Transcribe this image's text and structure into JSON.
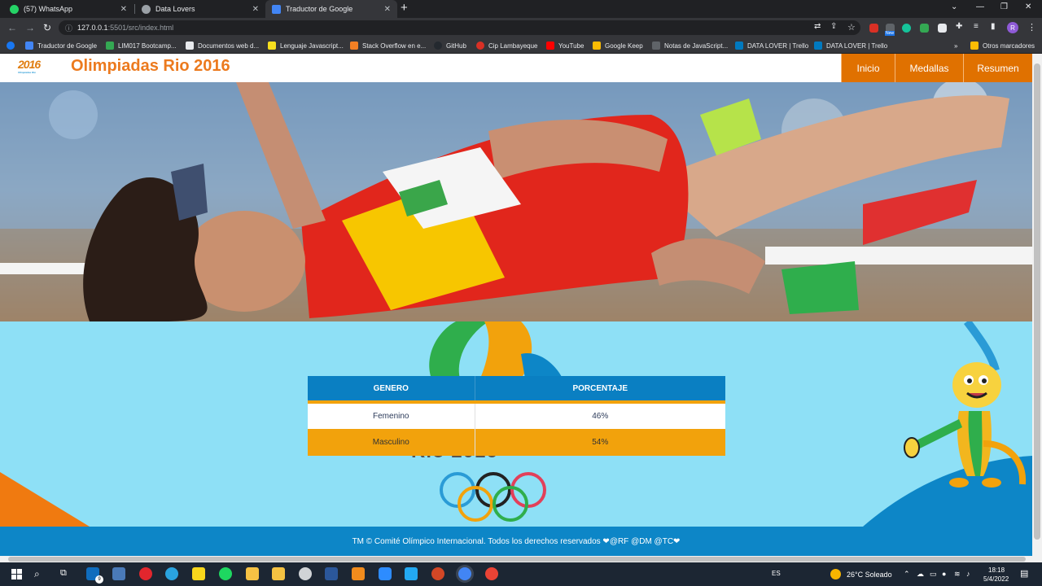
{
  "browser": {
    "tabs": [
      {
        "title": "(57) WhatsApp",
        "color": "#25d366"
      },
      {
        "title": "Data Lovers",
        "color": "#9aa0a6"
      },
      {
        "title": "Traductor de Google",
        "color": "#4285f4"
      }
    ],
    "url_host": "127.0.0.1",
    "url_path": ":5501/src/index.html",
    "bookmarks": [
      "Traductor de Google",
      "LIM017 Bootcamp...",
      "Documentos web d...",
      "Lenguaje Javascript...",
      "Stack Overflow en e...",
      "GitHub",
      "Cip Lambayeque",
      "YouTube",
      "Google Keep",
      "Notas de JavaScript...",
      "DATA LOVER | Trello",
      "DATA LOVER | Trello"
    ],
    "other_bookmarks": "Otros marcadores",
    "more_bookmarks": "»",
    "new_badge": "New",
    "profile_initial": "R"
  },
  "page": {
    "logo_text": "2016",
    "logo_sub": "Olimpíadas Rio",
    "title": "Olimpiadas Rio 2016",
    "nav": [
      "Inicio",
      "Medallas",
      "Resumen"
    ],
    "table": {
      "headers": [
        "GENERO",
        "PORCENTAJE"
      ],
      "rows": [
        {
          "genero": "Femenino",
          "porcentaje": "46%"
        },
        {
          "genero": "Masculino",
          "porcentaje": "54%"
        }
      ]
    },
    "background_text": "Rio 2016",
    "footer": "TM © Comité Olímpico Internacional. Todos los derechos reservados ❤@RF @DM @TC❤",
    "colors": {
      "orange": "#e07100",
      "blue": "#0d86c7",
      "light_blue": "#8ee0f6",
      "yellow": "#f2a20c"
    }
  },
  "taskbar": {
    "badge": "9",
    "language": "ES",
    "weather": "26°C  Soleado",
    "time": "18:18",
    "date": "5/4/2022"
  }
}
